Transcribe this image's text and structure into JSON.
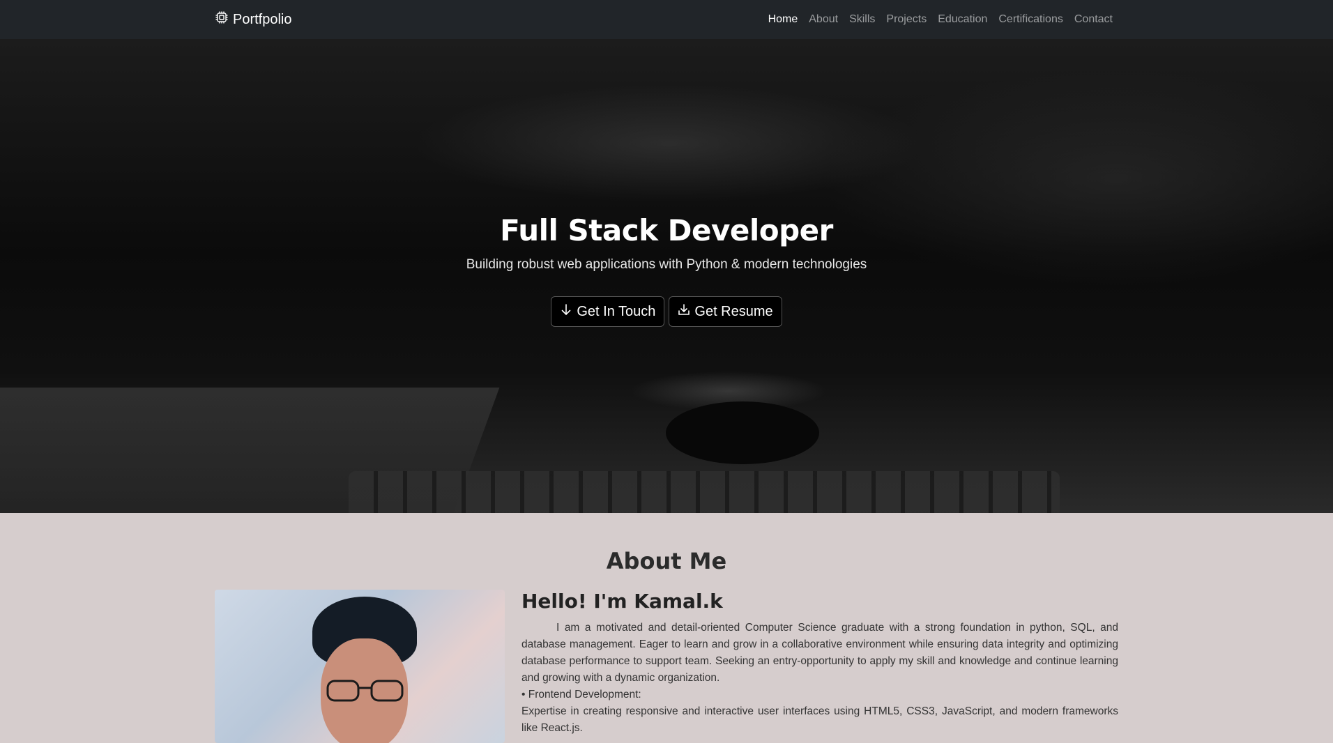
{
  "navbar": {
    "brand": "Portfpolio",
    "links": [
      "Home",
      "About",
      "Skills",
      "Projects",
      "Education",
      "Certifications",
      "Contact"
    ],
    "active": "Home"
  },
  "hero": {
    "title": "Full Stack Developer",
    "subtitle": "Building robust web applications with Python & modern technologies",
    "buttons": {
      "touch": "Get In Touch",
      "resume": "Get Resume"
    }
  },
  "about": {
    "title": "About Me",
    "greeting": "Hello! I'm Kamal.k",
    "paragraph": "I am a motivated and detail-oriented Computer Science graduate with a strong foundation in python, SQL, and database management. Eager to learn and grow in a collaborative environment while ensuring data integrity and optimizing database performance to support team. Seeking an entry-opportunity to apply my skill and knowledge and continue learning and growing with a dynamic organization.",
    "bullet_heading": "• Frontend Development:",
    "bullet_text": "Expertise in creating responsive and interactive user interfaces using HTML5, CSS3, JavaScript, and modern frameworks like React.js."
  },
  "colors": {
    "navbar_bg": "#212529",
    "about_bg": "#d6cdcd"
  },
  "icons": {
    "brand": "cpu-icon",
    "touch": "arrow-down-icon",
    "resume": "download-icon"
  }
}
